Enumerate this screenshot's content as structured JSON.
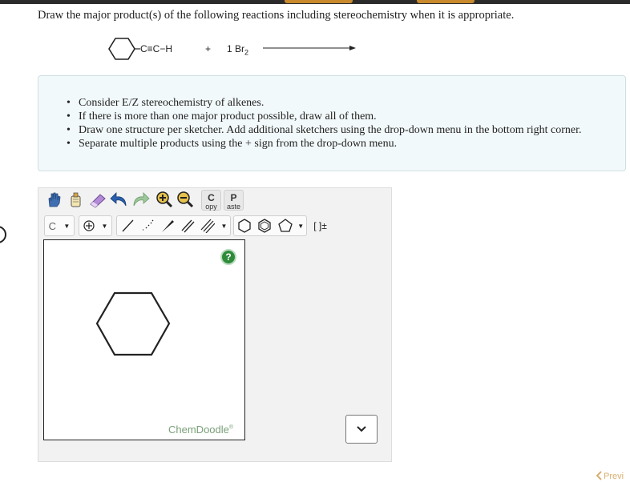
{
  "question": {
    "prompt": "Draw the major product(s) of the following reactions including stereochemistry when it is appropriate."
  },
  "reaction": {
    "reactant_substituent": "C≡C−H",
    "plus": "+",
    "reagent_coefficient": "1 Br",
    "reagent_subscript": "2"
  },
  "instructions": {
    "items": [
      "Consider E/Z stereochemistry of alkenes.",
      "If there is more than one major product possible, draw all of them.",
      "Draw one structure per sketcher. Add additional sketchers using the drop-down menu in the bottom right corner.",
      "Separate multiple products using the + sign from the drop-down menu."
    ]
  },
  "toolbar": {
    "copy_big": "C",
    "copy_small": "opy",
    "paste_big": "P",
    "paste_small": "aste",
    "element_label": "C",
    "charge_label": "[ ]±"
  },
  "canvas": {
    "help_label": "?",
    "watermark": "ChemDoodle",
    "watermark_mark": "®"
  },
  "footer": {
    "prev_label": "Previ"
  },
  "colors": {
    "help_green": "#2e8b3a",
    "panel_bg": "#f2f9fa",
    "accent_orange": "#c98a2e"
  }
}
